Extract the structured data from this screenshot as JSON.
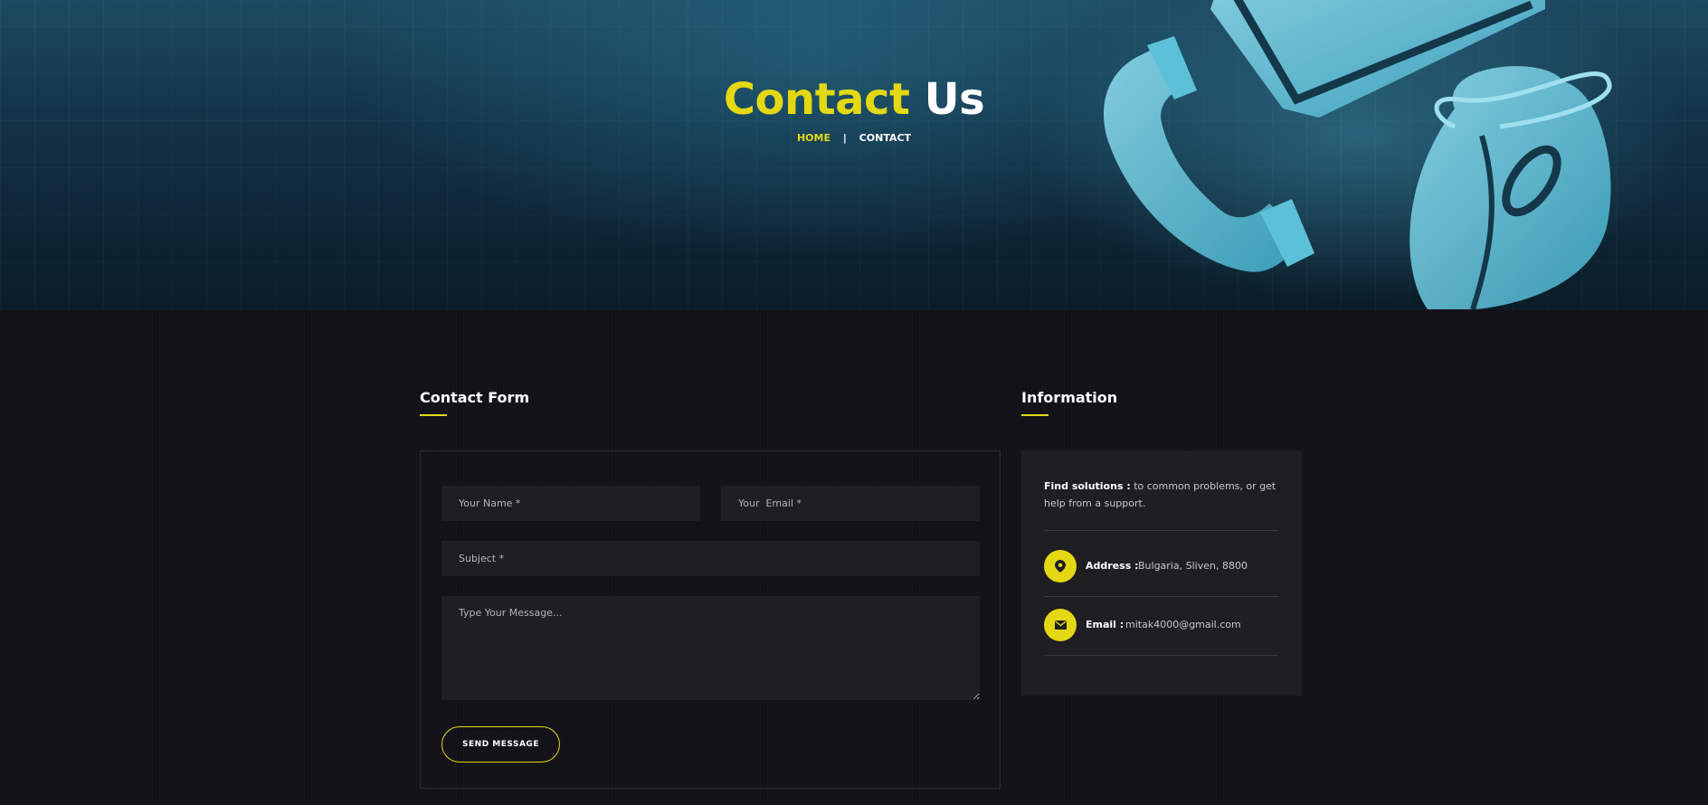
{
  "hero": {
    "title_accent": "Contact",
    "title_rest": "Us",
    "breadcrumb": {
      "home": "HOME",
      "separator": "|",
      "current": "CONTACT"
    }
  },
  "contact_form": {
    "heading": "Contact Form",
    "name_placeholder": "Your Name *",
    "email_placeholder": "Your  Email *",
    "subject_placeholder": "Subject *",
    "message_placeholder": "Type Your Message...",
    "submit_label": "SEND MESSAGE"
  },
  "information": {
    "heading": "Information",
    "intro_bold": "Find solutions :",
    "intro_text": "to common problems, or get help from a support.",
    "address_label": "Address :",
    "address_value": "Bulgaria, Sliven, 8800",
    "address_icon": "map-pin-icon",
    "email_label": "Email :",
    "email_value": "mitak4000@gmail.com",
    "email_icon": "envelope-icon"
  },
  "colors": {
    "accent": "#e4d812",
    "background": "#141219",
    "panel": "#1f1e23"
  }
}
